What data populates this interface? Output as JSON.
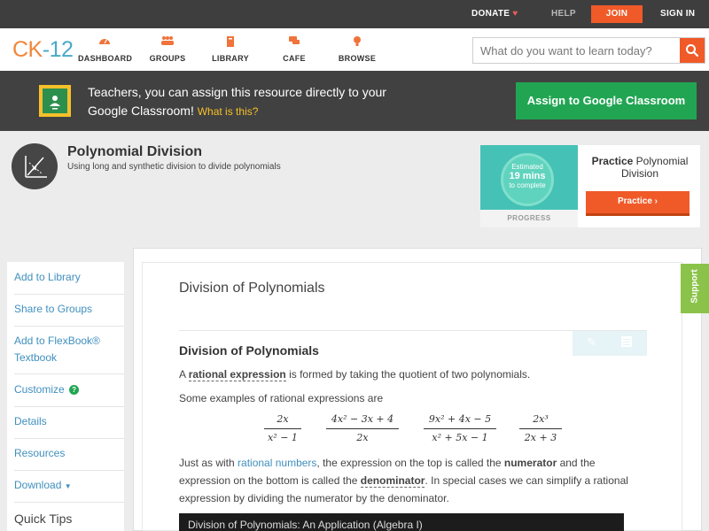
{
  "topbar": {
    "donate": "DONATE",
    "help": "HELP",
    "join": "JOIN",
    "signin": "SIGN IN"
  },
  "nav": {
    "logo_ck": "CK",
    "logo_dash": "-",
    "logo_num": "12",
    "items": [
      {
        "label": "DASHBOARD",
        "icon": "dashboard-icon"
      },
      {
        "label": "GROUPS",
        "icon": "groups-icon"
      },
      {
        "label": "LIBRARY",
        "icon": "library-icon"
      },
      {
        "label": "CAFE",
        "icon": "cafe-icon"
      },
      {
        "label": "BROWSE",
        "icon": "browse-icon"
      }
    ],
    "search_placeholder": "What do you want to learn today?"
  },
  "banner": {
    "text": "Teachers, you can assign this resource directly to your Google Classroom!",
    "what_link": "What is this?",
    "button": "Assign to Google Classroom"
  },
  "concept": {
    "title": "Polynomial Division",
    "subtitle": "Using long and synthetic division to divide polynomials"
  },
  "practice": {
    "estimated": "Estimated",
    "mins": "19 mins",
    "complete": "to complete",
    "progress_label": "PROGRESS",
    "title_bold": "Practice",
    "title_rest": "Polynomial Division",
    "button": "Practice"
  },
  "sidebar": {
    "items": [
      "Add to Library",
      "Share to Groups",
      "Add to FlexBook® Textbook",
      "Customize",
      "Details",
      "Resources",
      "Download"
    ],
    "quick_tips": "Quick Tips"
  },
  "content": {
    "page_title": "Division of Polynomials",
    "section_heading": "Division of Polynomials",
    "p1_a": "A ",
    "p1_term": "rational expression",
    "p1_b": " is formed by taking the quotient of two polynomials.",
    "p2": "Some examples of rational expressions are",
    "fractions": [
      {
        "num": "2x",
        "den": "x² − 1"
      },
      {
        "num": "4x² − 3x + 4",
        "den": "2x"
      },
      {
        "num": "9x² + 4x − 5",
        "den": "x² + 5x − 1"
      },
      {
        "num": "2x³",
        "den": "2x + 3"
      }
    ],
    "p3_a": "Just as with ",
    "p3_link": "rational numbers",
    "p3_b": ", the expression on the top is called the ",
    "p3_num": "numerator",
    "p3_c": " and the expression on the bottom is called the ",
    "p3_den": "denominator",
    "p3_d": ". In special cases we can simplify a rational expression by dividing the numerator by the denominator.",
    "video_title": "Division of Polynomials: An Application (Algebra I)"
  },
  "support": "Support",
  "colors": {
    "accent": "#f05a28",
    "link": "#3f8fbe",
    "google_green": "#22a553"
  }
}
